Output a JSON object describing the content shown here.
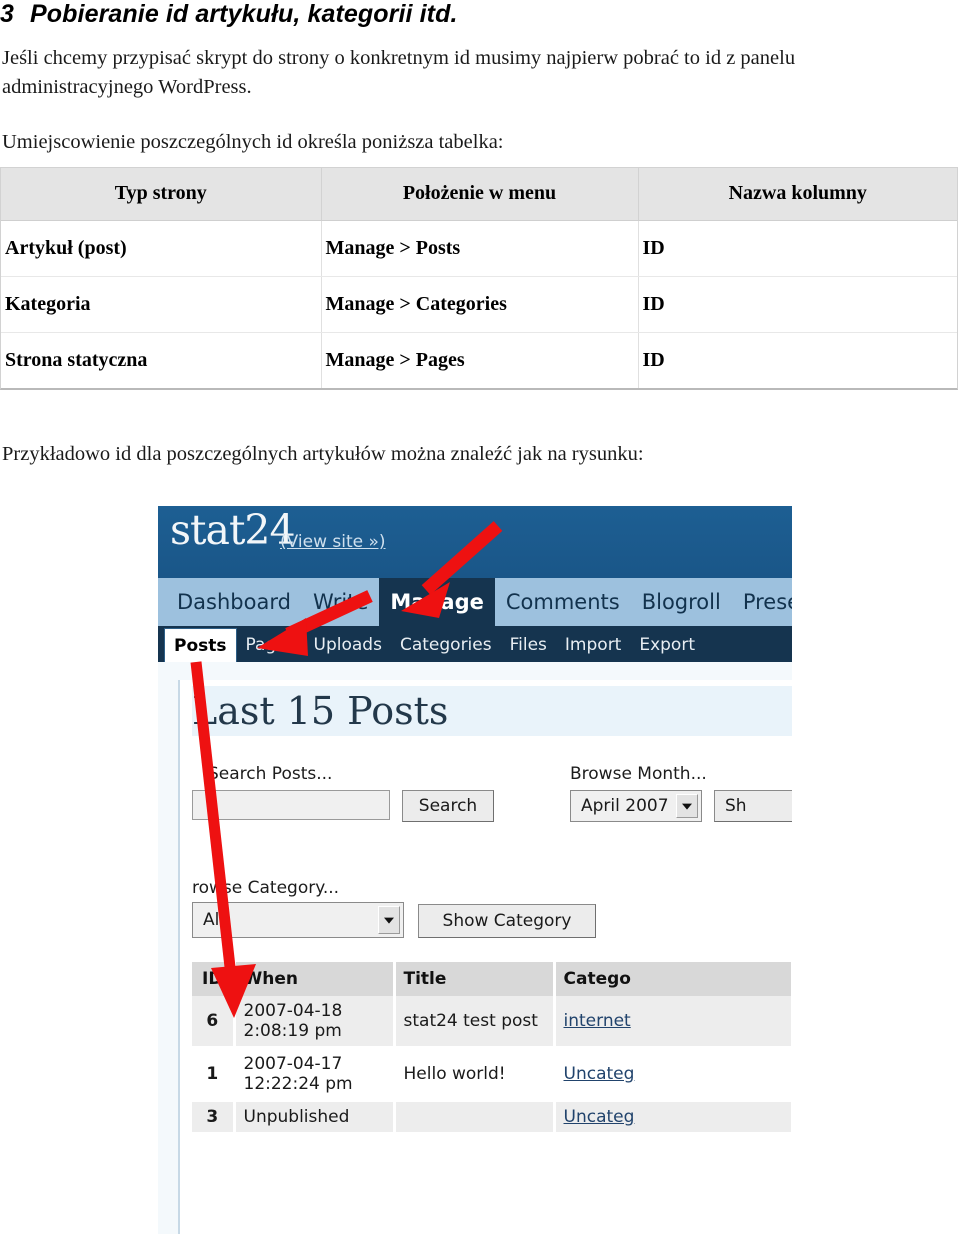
{
  "document": {
    "heading_number": "3",
    "heading_text": "Pobieranie id artykułu, kategorii itd.",
    "intro_paragraph": "Jeśli chcemy przypisać skrypt do strony o konkretnym id musimy najpierw pobrać to id z panelu administracyjnego WordPress.",
    "table_lead": "Umiejscowienie poszczególnych id określa poniższa tabelka:",
    "example_lead": "Przykładowo id dla poszczególnych artykułów można znaleźć jak na rysunku:"
  },
  "id_table": {
    "headers": [
      "Typ strony",
      "Położenie w menu",
      "Nazwa kolumny"
    ],
    "rows": [
      {
        "type": "Artykuł (post)",
        "location": "Manage > Posts",
        "column": "ID"
      },
      {
        "type": "Kategoria",
        "location": "Manage > Categories",
        "column": "ID"
      },
      {
        "type": "Strona statyczna",
        "location": "Manage > Pages",
        "column": "ID"
      }
    ]
  },
  "screenshot": {
    "header": {
      "logo": "stat24",
      "view_site": "(View site »)"
    },
    "primary_nav": [
      {
        "label": "Dashboard",
        "active": false
      },
      {
        "label": "Write",
        "active": false
      },
      {
        "label": "Manage",
        "active": true
      },
      {
        "label": "Comments",
        "active": false
      },
      {
        "label": "Blogroll",
        "active": false
      },
      {
        "label": "Presen",
        "active": false
      }
    ],
    "secondary_nav": [
      {
        "label": "Posts",
        "active": true
      },
      {
        "label": "Pages",
        "active": false
      },
      {
        "label": "Uploads",
        "active": false
      },
      {
        "label": "Categories",
        "active": false
      },
      {
        "label": "Files",
        "active": false
      },
      {
        "label": "Import",
        "active": false
      },
      {
        "label": "Export",
        "active": false
      }
    ],
    "panel": {
      "title": "Last 15 Posts",
      "search_label": "Search Posts...",
      "search_value": "",
      "search_button": "Search",
      "month_label": "Browse Month...",
      "month_value": "April 2007",
      "month_button": "Sh",
      "category_label": "rowse Category...",
      "category_value": "All",
      "category_button": "Show Category"
    },
    "posts_table": {
      "headers": [
        "ID",
        "When",
        "Title",
        "Catego"
      ],
      "rows": [
        {
          "id": "6",
          "when_line1": "2007-04-18",
          "when_line2": "2:08:19 pm",
          "title": "stat24 test post",
          "category": "internet"
        },
        {
          "id": "1",
          "when_line1": "2007-04-17",
          "when_line2": "12:22:24 pm",
          "title": "Hello world!",
          "category": "Uncateg"
        },
        {
          "id": "3",
          "when_line1": "Unpublished",
          "when_line2": "",
          "title": "",
          "category": "Uncateg"
        }
      ]
    },
    "annotations": {
      "arrow_color": "#ee1111",
      "arrow_to_manage": "arrow pointing at Manage menu item",
      "arrow_to_posts": "arrow pointing at Posts sub-tab",
      "arrow_to_id": "arrow pointing down at ID column"
    }
  },
  "colors": {
    "wp_header_blue": "#1a5a8e",
    "wp_nav_light_blue": "#9dc1de",
    "wp_nav_dark_blue": "#15344f",
    "table_header_gray": "#e4e4e4",
    "arrow_red": "#ee1111"
  }
}
